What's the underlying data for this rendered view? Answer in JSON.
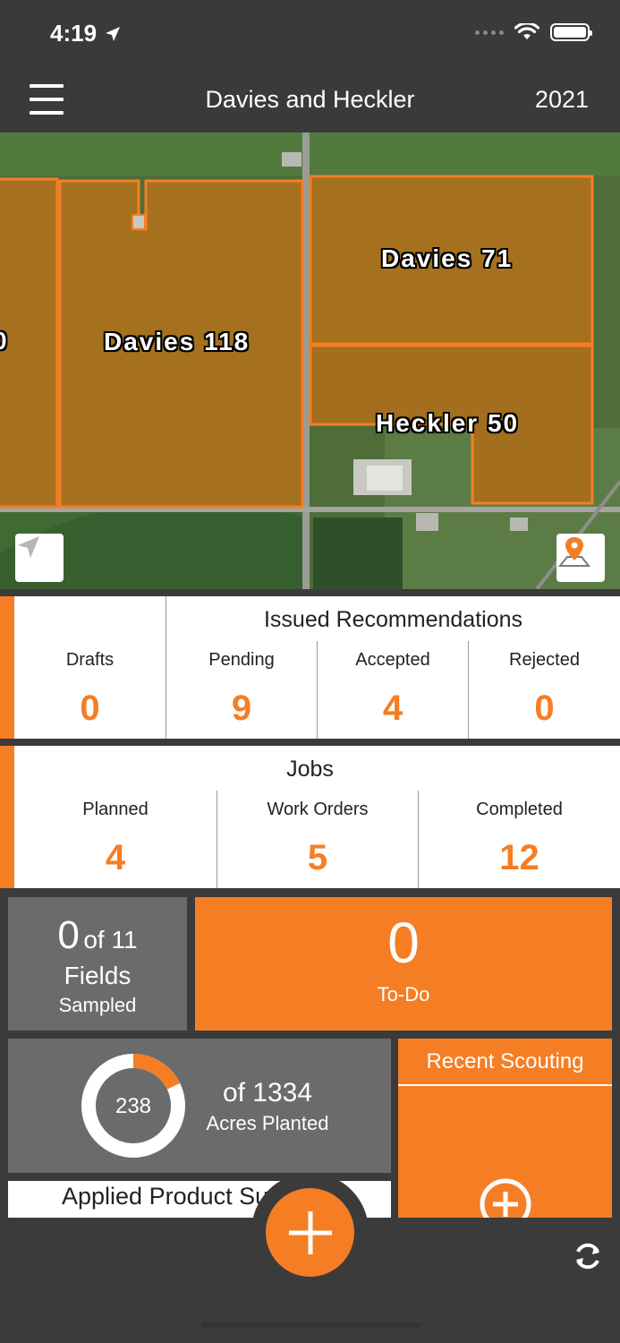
{
  "status_bar": {
    "time": "4:19"
  },
  "header": {
    "title": "Davies and Heckler",
    "year": "2021"
  },
  "map": {
    "labels": {
      "davies118": "Davies 118",
      "davies71": "Davies 71",
      "heckler50": "Heckler 50",
      "edge": "0"
    }
  },
  "recommendations": {
    "title": "Issued Recommendations",
    "drafts": {
      "label": "Drafts",
      "value": "0"
    },
    "pending": {
      "label": "Pending",
      "value": "9"
    },
    "accepted": {
      "label": "Accepted",
      "value": "4"
    },
    "rejected": {
      "label": "Rejected",
      "value": "0"
    }
  },
  "jobs": {
    "title": "Jobs",
    "planned": {
      "label": "Planned",
      "value": "4"
    },
    "work_orders": {
      "label": "Work Orders",
      "value": "5"
    },
    "completed": {
      "label": "Completed",
      "value": "12"
    }
  },
  "sampling": {
    "count": "0",
    "of_total": "of 11",
    "fields": "Fields",
    "sampled": "Sampled"
  },
  "todo": {
    "count": "0",
    "label": "To-Do"
  },
  "planted": {
    "acres": "238",
    "of_total": "of 1334",
    "label": "Acres Planted",
    "fraction": 0.178
  },
  "recent_scouting": {
    "title": "Recent Scouting"
  },
  "applied_product": {
    "label": "Applied Product Summary"
  },
  "colors": {
    "accent": "#f57e25",
    "tile_gray": "#6b6b6b"
  }
}
